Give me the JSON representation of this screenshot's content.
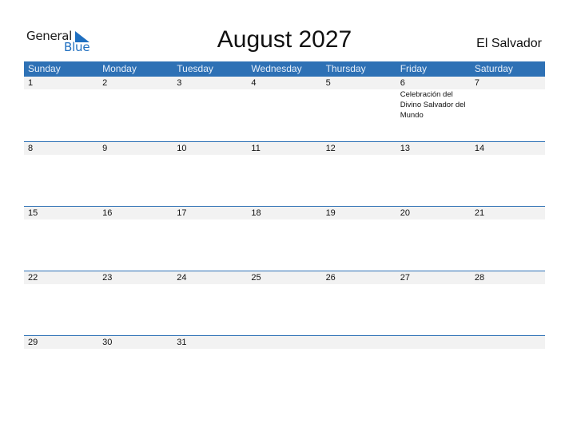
{
  "logo": {
    "word1": "General",
    "word2": "Blue"
  },
  "title": "August 2027",
  "country": "El Salvador",
  "colors": {
    "accent": "#2e71b5",
    "band": "#f2f2f2",
    "logo_blue": "#1f6fc0"
  },
  "weekdays": [
    "Sunday",
    "Monday",
    "Tuesday",
    "Wednesday",
    "Thursday",
    "Friday",
    "Saturday"
  ],
  "weeks": [
    {
      "days": [
        {
          "num": "1",
          "event": ""
        },
        {
          "num": "2",
          "event": ""
        },
        {
          "num": "3",
          "event": ""
        },
        {
          "num": "4",
          "event": ""
        },
        {
          "num": "5",
          "event": ""
        },
        {
          "num": "6",
          "event": "Celebración del Divino Salvador del Mundo"
        },
        {
          "num": "7",
          "event": ""
        }
      ]
    },
    {
      "days": [
        {
          "num": "8",
          "event": ""
        },
        {
          "num": "9",
          "event": ""
        },
        {
          "num": "10",
          "event": ""
        },
        {
          "num": "11",
          "event": ""
        },
        {
          "num": "12",
          "event": ""
        },
        {
          "num": "13",
          "event": ""
        },
        {
          "num": "14",
          "event": ""
        }
      ]
    },
    {
      "days": [
        {
          "num": "15",
          "event": ""
        },
        {
          "num": "16",
          "event": ""
        },
        {
          "num": "17",
          "event": ""
        },
        {
          "num": "18",
          "event": ""
        },
        {
          "num": "19",
          "event": ""
        },
        {
          "num": "20",
          "event": ""
        },
        {
          "num": "21",
          "event": ""
        }
      ]
    },
    {
      "days": [
        {
          "num": "22",
          "event": ""
        },
        {
          "num": "23",
          "event": ""
        },
        {
          "num": "24",
          "event": ""
        },
        {
          "num": "25",
          "event": ""
        },
        {
          "num": "26",
          "event": ""
        },
        {
          "num": "27",
          "event": ""
        },
        {
          "num": "28",
          "event": ""
        }
      ]
    },
    {
      "days": [
        {
          "num": "29",
          "event": ""
        },
        {
          "num": "30",
          "event": ""
        },
        {
          "num": "31",
          "event": ""
        },
        {
          "num": "",
          "event": ""
        },
        {
          "num": "",
          "event": ""
        },
        {
          "num": "",
          "event": ""
        },
        {
          "num": "",
          "event": ""
        }
      ]
    }
  ]
}
